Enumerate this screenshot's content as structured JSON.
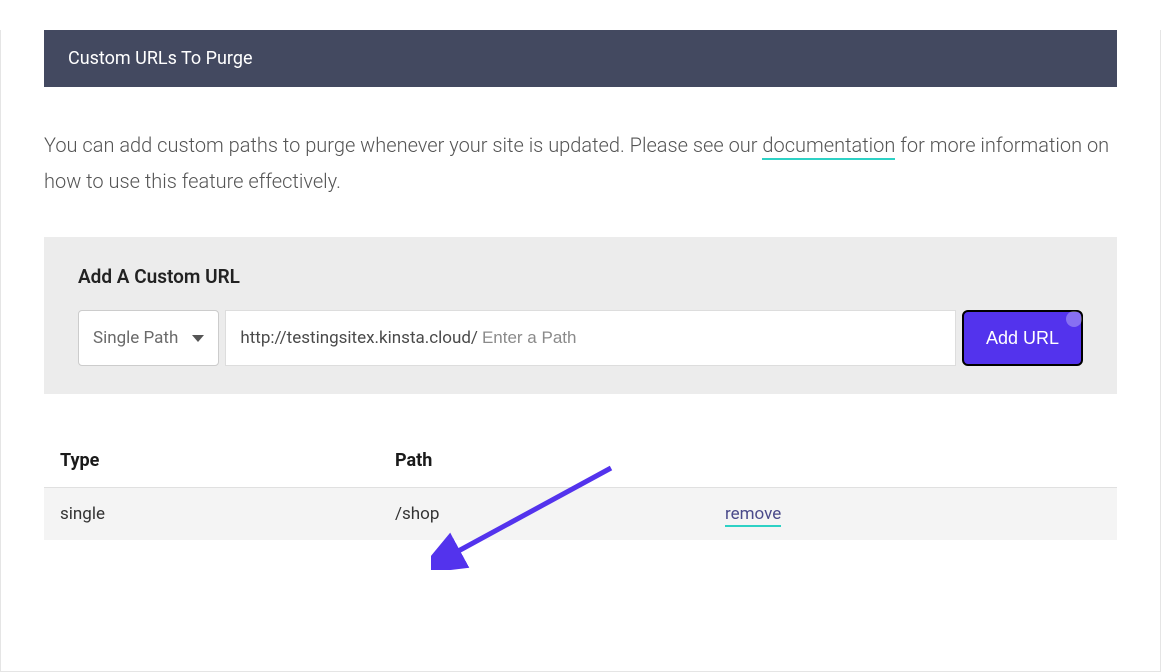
{
  "header": {
    "title": "Custom URLs To Purge"
  },
  "description": {
    "text_before": "You can add custom paths to purge whenever your site is updated. Please see our ",
    "link_text": "documentation",
    "text_after": " for more information on how to use this feature effectively."
  },
  "form": {
    "title": "Add A Custom URL",
    "path_type_selected": "Single Path",
    "url_prefix": "http://testingsitex.kinsta.cloud/",
    "url_placeholder": "Enter a Path",
    "add_button_label": "Add URL"
  },
  "table": {
    "headers": {
      "type": "Type",
      "path": "Path"
    },
    "rows": [
      {
        "type": "single",
        "path": "/shop",
        "action_label": "remove"
      }
    ]
  }
}
